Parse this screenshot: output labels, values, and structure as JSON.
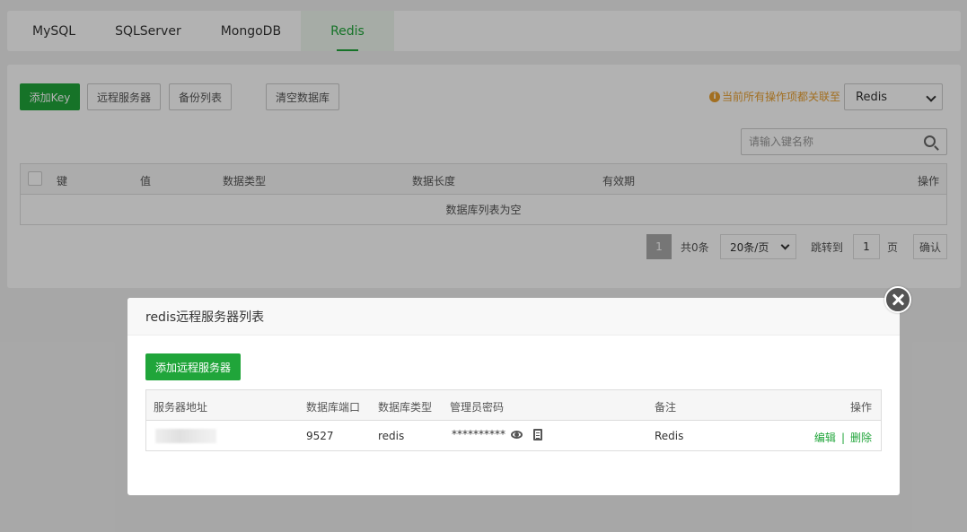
{
  "tabs": [
    "MySQL",
    "SQLServer",
    "MongoDB",
    "Redis"
  ],
  "toolbar": {
    "add_key": "添加Key",
    "remote_servers": "远程服务器",
    "backup_list": "备份列表",
    "clear_db": "清空数据库"
  },
  "notice": {
    "text": "当前所有操作项都关联至",
    "icon": "info-icon"
  },
  "db_select": {
    "value": "Redis"
  },
  "search": {
    "placeholder": "请输入键名称"
  },
  "table": {
    "headers": {
      "key": "键",
      "value": "值",
      "type": "数据类型",
      "length": "数据长度",
      "ttl": "有效期",
      "actions": "操作"
    },
    "empty_text": "数据库列表为空"
  },
  "pagination": {
    "current": "1",
    "total": "共0条",
    "per_page": "20条/页",
    "jump_label": "跳转到",
    "jump_value": "1",
    "page_unit": "页",
    "confirm": "确认"
  },
  "modal": {
    "title": "redis远程服务器列表",
    "add_button": "添加远程服务器",
    "headers": {
      "address": "服务器地址",
      "port": "数据库端口",
      "type": "数据库类型",
      "password": "管理员密码",
      "remark": "备注",
      "actions": "操作"
    },
    "rows": [
      {
        "port": "9527",
        "type": "redis",
        "password": "**********",
        "remark": "Redis",
        "edit": "编辑",
        "sep": "|",
        "delete": "删除"
      }
    ]
  },
  "colors": {
    "accent": "#20a53a",
    "warning": "#e8a030"
  }
}
